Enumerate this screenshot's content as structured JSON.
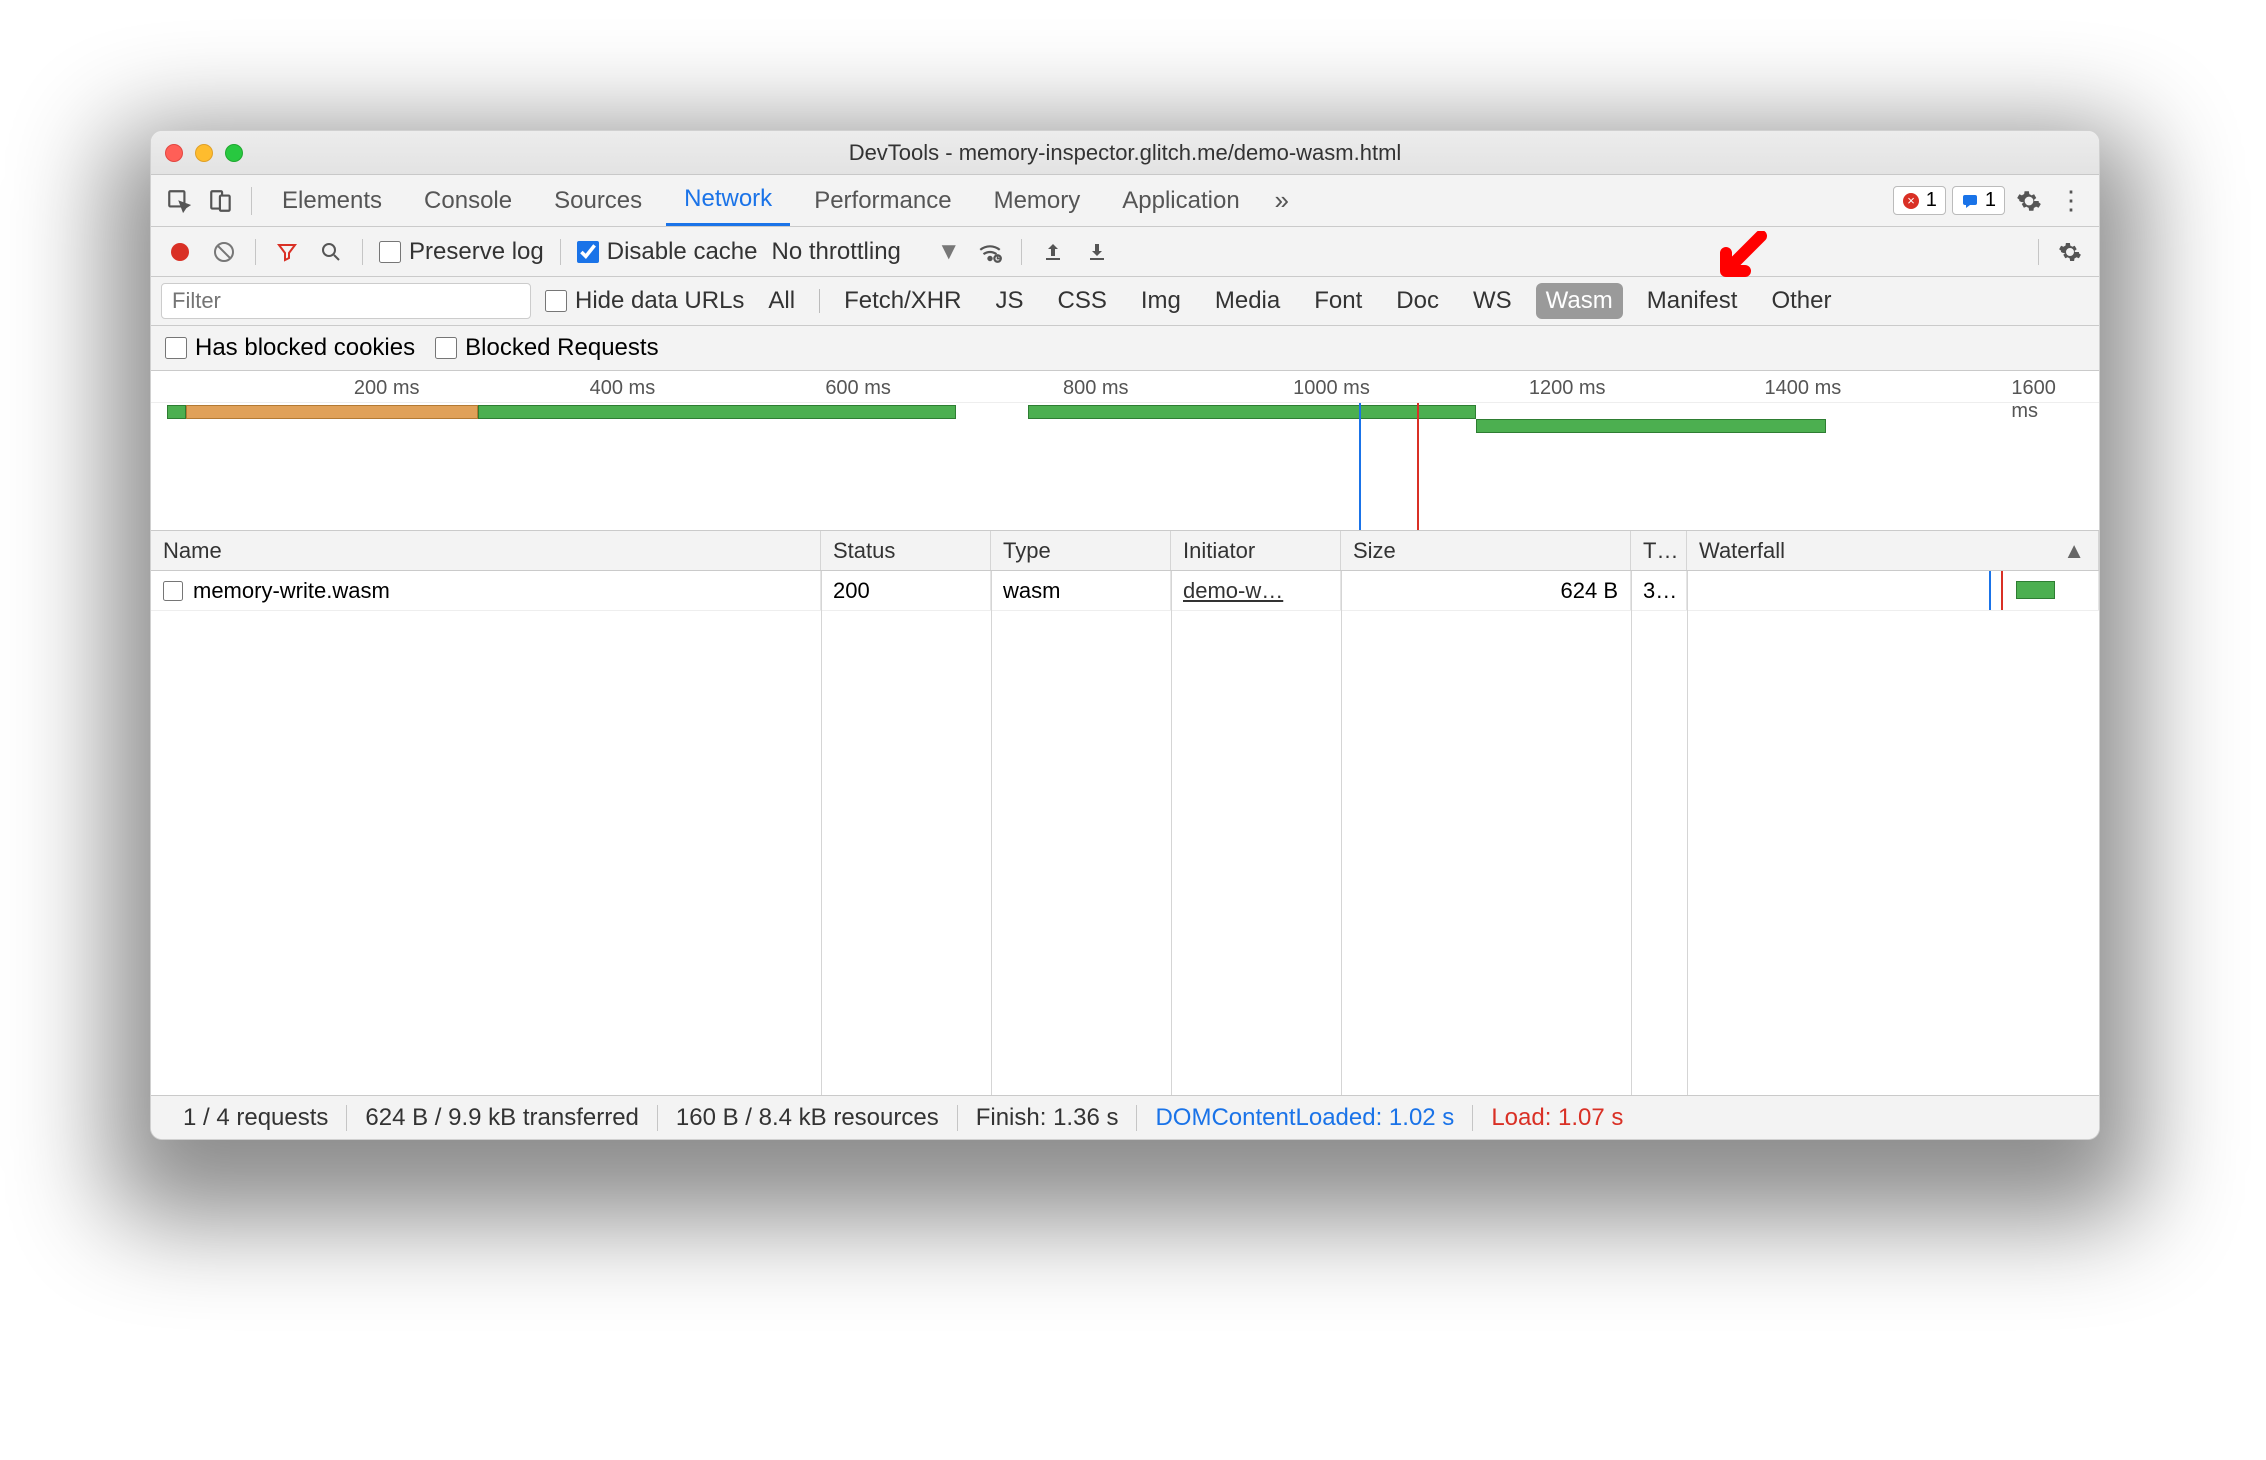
{
  "window": {
    "title": "DevTools - memory-inspector.glitch.me/demo-wasm.html"
  },
  "tabs": {
    "items": [
      "Elements",
      "Console",
      "Sources",
      "Network",
      "Performance",
      "Memory",
      "Application"
    ],
    "active": "Network",
    "error_count": "1",
    "messages_count": "1"
  },
  "toolbar": {
    "preserve_log": "Preserve log",
    "disable_cache": "Disable cache",
    "throttling": "No throttling"
  },
  "filterbar": {
    "placeholder": "Filter",
    "hide_data_urls": "Hide data URLs",
    "types": [
      "All",
      "Fetch/XHR",
      "JS",
      "CSS",
      "Img",
      "Media",
      "Font",
      "Doc",
      "WS",
      "Wasm",
      "Manifest",
      "Other"
    ],
    "active_type": "Wasm",
    "has_blocked_cookies": "Has blocked cookies",
    "blocked_requests": "Blocked Requests"
  },
  "overview": {
    "ticks": [
      "200 ms",
      "400 ms",
      "600 ms",
      "800 ms",
      "1000 ms",
      "1200 ms",
      "1400 ms",
      "1600 ms"
    ]
  },
  "grid": {
    "headers": {
      "name": "Name",
      "status": "Status",
      "type": "Type",
      "initiator": "Initiator",
      "size": "Size",
      "time": "T…",
      "waterfall": "Waterfall"
    },
    "rows": [
      {
        "name": "memory-write.wasm",
        "status": "200",
        "type": "wasm",
        "initiator": "demo-w…",
        "size": "624 B",
        "time": "3…"
      }
    ]
  },
  "status": {
    "requests": "1 / 4 requests",
    "transferred": "624 B / 9.9 kB transferred",
    "resources": "160 B / 8.4 kB resources",
    "finish": "Finish: 1.36 s",
    "dcl": "DOMContentLoaded: 1.02 s",
    "load": "Load: 1.07 s"
  }
}
